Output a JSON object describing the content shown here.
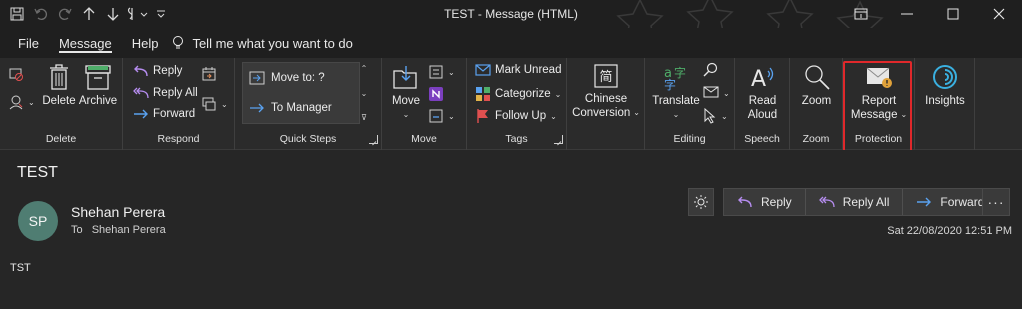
{
  "window": {
    "title": "TEST  -  Message (HTML)",
    "controls": [
      "restore-ribbon",
      "minimize",
      "maximize",
      "close"
    ]
  },
  "tabs": [
    {
      "label": "File",
      "active": false
    },
    {
      "label": "Message",
      "active": true
    },
    {
      "label": "Help",
      "active": false
    }
  ],
  "tellme": {
    "text": "Tell me what you want to do"
  },
  "ribbon": {
    "delete_group": {
      "label": "Delete",
      "delete": "Delete",
      "archive": "Archive"
    },
    "respond_group": {
      "label": "Respond",
      "reply": "Reply",
      "reply_all": "Reply All",
      "forward": "Forward"
    },
    "quicksteps_group": {
      "label": "Quick Steps",
      "items": [
        "Move to: ?",
        "To Manager"
      ]
    },
    "move_group": {
      "label": "Move",
      "move": "Move"
    },
    "tags_group": {
      "label": "Tags",
      "mark_unread": "Mark Unread",
      "categorize": "Categorize",
      "follow_up": "Follow Up"
    },
    "chinese_group": {
      "line1": "Chinese",
      "line2": "Conversion"
    },
    "editing_group": {
      "label": "Editing",
      "translate": "Translate"
    },
    "speech_group": {
      "label": "Speech",
      "line1": "Read",
      "line2": "Aloud"
    },
    "zoom_group": {
      "label": "Zoom",
      "zoom": "Zoom"
    },
    "protection_group": {
      "label": "Protection",
      "line1": "Report",
      "line2": "Message"
    },
    "insights": {
      "label": "Insights"
    }
  },
  "message": {
    "subject": "TEST",
    "avatar_initials": "SP",
    "sender": "Shehan Perera",
    "to_label": "To",
    "to_name": "Shehan Perera",
    "body": "TST",
    "datetime": "Sat 22/08/2020 12:51 PM",
    "actions": {
      "reply": "Reply",
      "reply_all": "Reply All",
      "forward": "Forward",
      "more": "···"
    }
  },
  "colors": {
    "highlight": "#e0282b",
    "accent_blue": "#8ab4f8",
    "avatar": "#4f7d72"
  }
}
